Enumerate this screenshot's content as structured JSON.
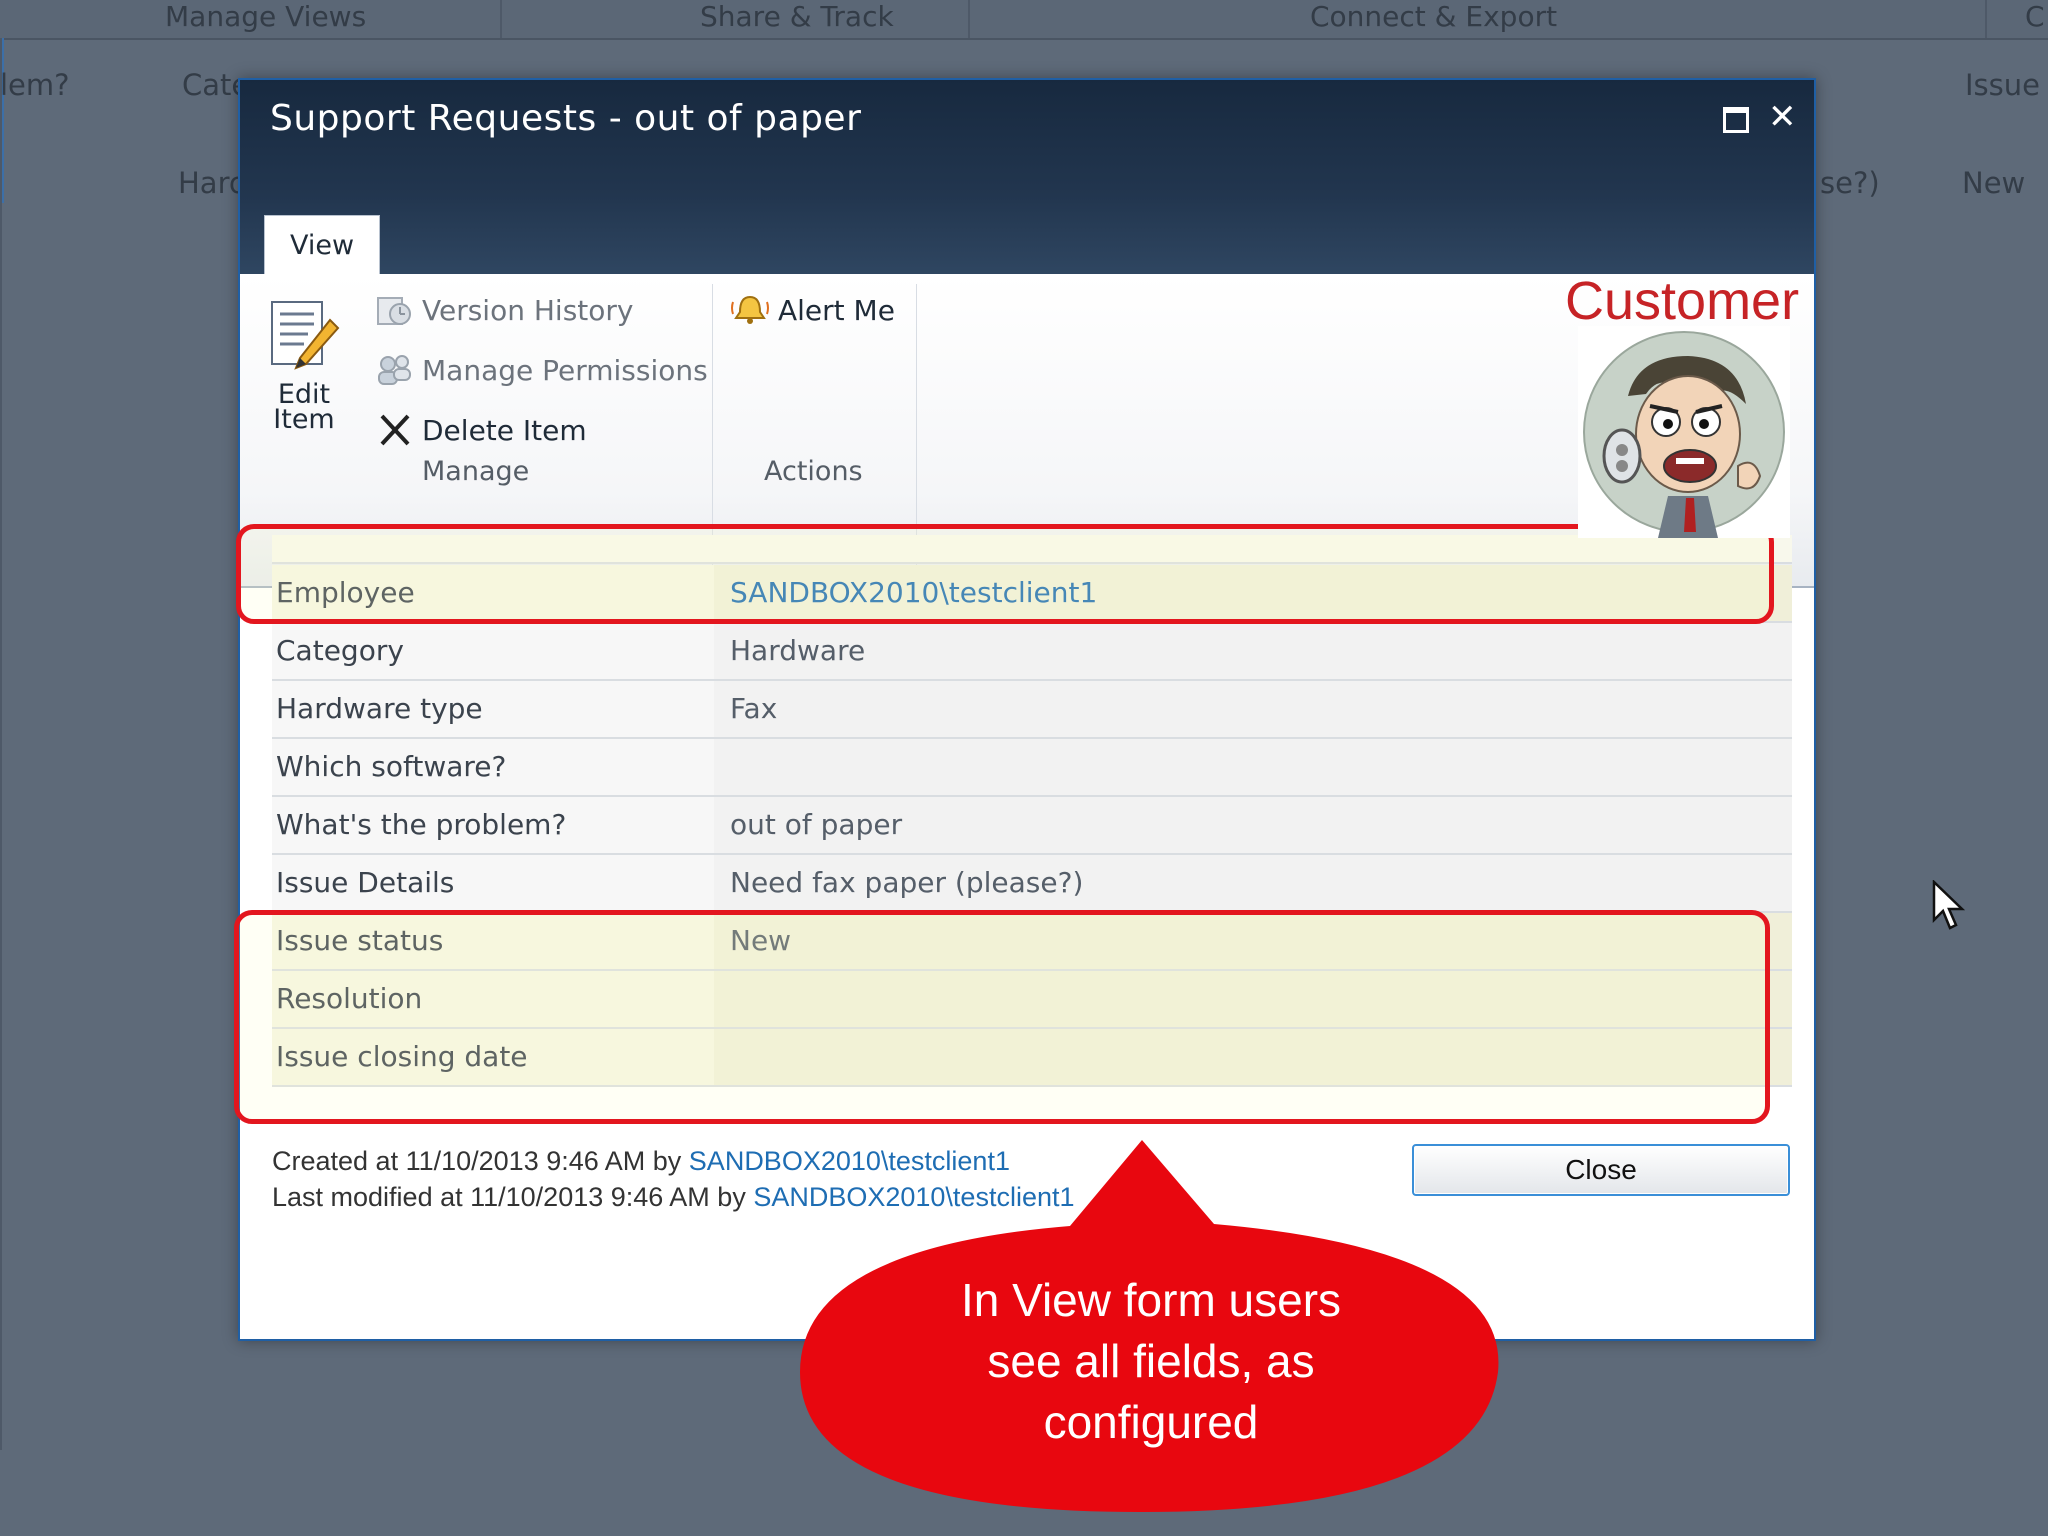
{
  "background": {
    "ribbon_groups": [
      "Manage Views",
      "Share & Track",
      "Connect & Export",
      "C"
    ],
    "column_fragments": [
      "lem?",
      "Cate",
      "Issue",
      "Harc",
      "se?)",
      "New"
    ]
  },
  "dialog": {
    "title": "Support Requests - out of paper",
    "tab": "View"
  },
  "ribbon": {
    "edit_item_label": "Edit Item",
    "version_history": "Version History",
    "manage_permissions": "Manage Permissions",
    "delete_item": "Delete Item",
    "alert_me": "Alert Me",
    "group_manage": "Manage",
    "group_actions": "Actions"
  },
  "annotation": {
    "customer_label": "Customer",
    "callout_line1": "In View form users",
    "callout_line2": "see all fields, as",
    "callout_line3": "configured"
  },
  "fields": [
    {
      "label": "Employee",
      "value": "SANDBOX2010\\testclient1"
    },
    {
      "label": "Category",
      "value": "Hardware"
    },
    {
      "label": "Hardware type",
      "value": "Fax"
    },
    {
      "label": "Which software?",
      "value": ""
    },
    {
      "label": "What's the problem?",
      "value": "out of paper"
    },
    {
      "label": "Issue Details",
      "value": "Need fax paper (please?)"
    },
    {
      "label": "Issue status",
      "value": "New"
    },
    {
      "label": "Resolution",
      "value": ""
    },
    {
      "label": "Issue closing date",
      "value": ""
    }
  ],
  "footer": {
    "created_prefix": "Created at 11/10/2013 9:46 AM by ",
    "created_by": "SANDBOX2010\\testclient1",
    "modified_prefix": "Last modified at 11/10/2013 9:46 AM by ",
    "modified_by": "SANDBOX2010\\testclient1",
    "close_button": "Close"
  },
  "colors": {
    "highlight_border": "#e3161e",
    "callout_fill": "#e8070f",
    "link": "#1e6db3",
    "titlebar": "#1c2f46"
  }
}
